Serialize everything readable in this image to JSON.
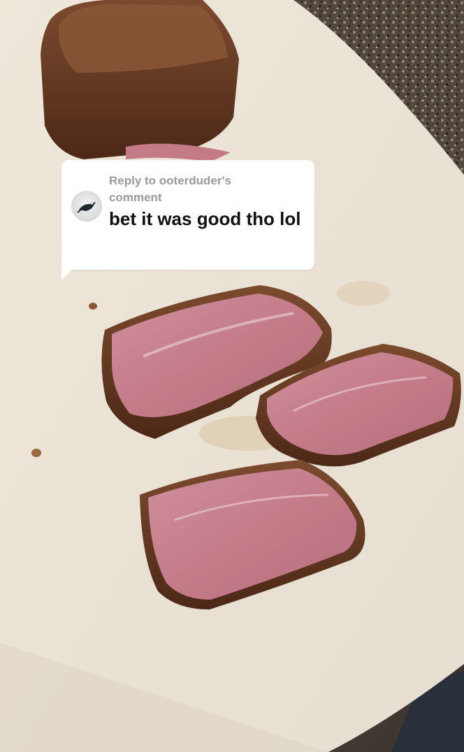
{
  "comment_sticker": {
    "reply_label": "Reply to ooterduder's comment",
    "comment_text": "bet it was good tho lol"
  },
  "icons": {
    "avatar": "bird-avatar-icon"
  },
  "colors": {
    "sticker_background": "#ffffff",
    "reply_label": "#9a9a9c",
    "comment_text": "#111111"
  }
}
